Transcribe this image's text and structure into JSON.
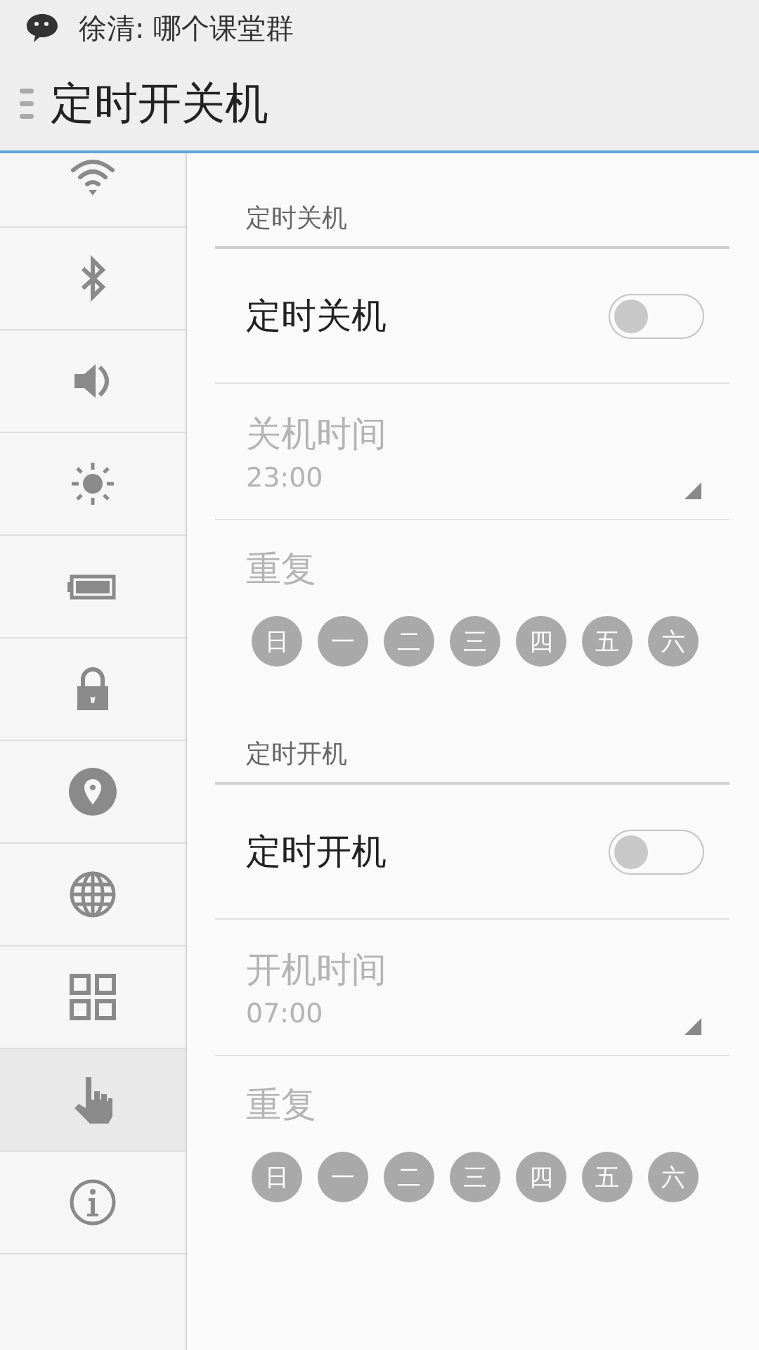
{
  "notification": {
    "text": "徐清: 哪个课堂群"
  },
  "title_bar": {
    "title": "定时开关机"
  },
  "sidebar": {
    "items": [
      {
        "kind": "wifi",
        "selected": false
      },
      {
        "kind": "bluetooth",
        "selected": false
      },
      {
        "kind": "sound",
        "selected": false
      },
      {
        "kind": "brightness",
        "selected": false
      },
      {
        "kind": "battery",
        "selected": false
      },
      {
        "kind": "lock",
        "selected": false
      },
      {
        "kind": "location",
        "selected": false
      },
      {
        "kind": "globe",
        "selected": false
      },
      {
        "kind": "apps",
        "selected": false
      },
      {
        "kind": "touch",
        "selected": true
      },
      {
        "kind": "info",
        "selected": false
      }
    ]
  },
  "sections": [
    {
      "header": "定时关机",
      "toggle": {
        "label": "定时关机",
        "on": false
      },
      "time": {
        "label": "关机时间",
        "value": "23:00",
        "disabled": true
      },
      "repeat": {
        "label": "重复",
        "disabled": true,
        "days": [
          {
            "label": "日",
            "selected": false
          },
          {
            "label": "一",
            "selected": false
          },
          {
            "label": "二",
            "selected": false
          },
          {
            "label": "三",
            "selected": false
          },
          {
            "label": "四",
            "selected": false
          },
          {
            "label": "五",
            "selected": false
          },
          {
            "label": "六",
            "selected": false
          }
        ]
      }
    },
    {
      "header": "定时开机",
      "toggle": {
        "label": "定时开机",
        "on": false
      },
      "time": {
        "label": "开机时间",
        "value": "07:00",
        "disabled": true
      },
      "repeat": {
        "label": "重复",
        "disabled": true,
        "days": [
          {
            "label": "日",
            "selected": false
          },
          {
            "label": "一",
            "selected": false
          },
          {
            "label": "二",
            "selected": false
          },
          {
            "label": "三",
            "selected": false
          },
          {
            "label": "四",
            "selected": false
          },
          {
            "label": "五",
            "selected": false
          },
          {
            "label": "六",
            "selected": false
          }
        ]
      }
    }
  ]
}
